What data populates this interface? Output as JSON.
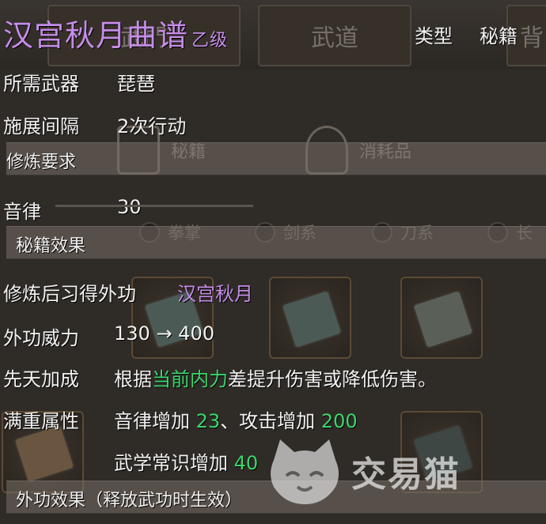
{
  "background": {
    "tabs": [
      "武門",
      "武道",
      "背"
    ],
    "categories": [
      "秘籍",
      "消耗品"
    ],
    "filters": [
      "拳掌",
      "剑系",
      "刀系",
      "长"
    ]
  },
  "tooltip": {
    "title": "汉宫秋月曲谱",
    "grade": "乙级",
    "type_label": "类型",
    "type_value": "秘籍",
    "weapon_label": "所需武器",
    "weapon_value": "琵琶",
    "interval_label": "施展间隔",
    "interval_value": "2次行动",
    "req_section": "修炼要求",
    "rhythm_label": "音律",
    "rhythm_value": "30",
    "effect_section": "秘籍效果",
    "learn_label": "修炼后习得外功",
    "learn_value": "汉宫秋月",
    "power_label": "外功威力",
    "power_value": "130 → 400",
    "innate_label": "先天加成",
    "innate_prefix": "根据",
    "innate_highlight": "当前内力",
    "innate_suffix": "差提升伤害或降低伤害。",
    "full_label": "满重属性",
    "full_line1_a": "音律增加",
    "full_line1_a_val": "23",
    "full_line1_sep": "、攻击增加",
    "full_line1_b_val": "200",
    "full_line2_a": "武学常识增加",
    "full_line2_a_val": "40",
    "external_section": "外功效果（释放武功时生效）"
  },
  "watermark": {
    "text": "交易猫"
  },
  "colors": {
    "purple": "#c58de8",
    "green": "#39d76c"
  }
}
